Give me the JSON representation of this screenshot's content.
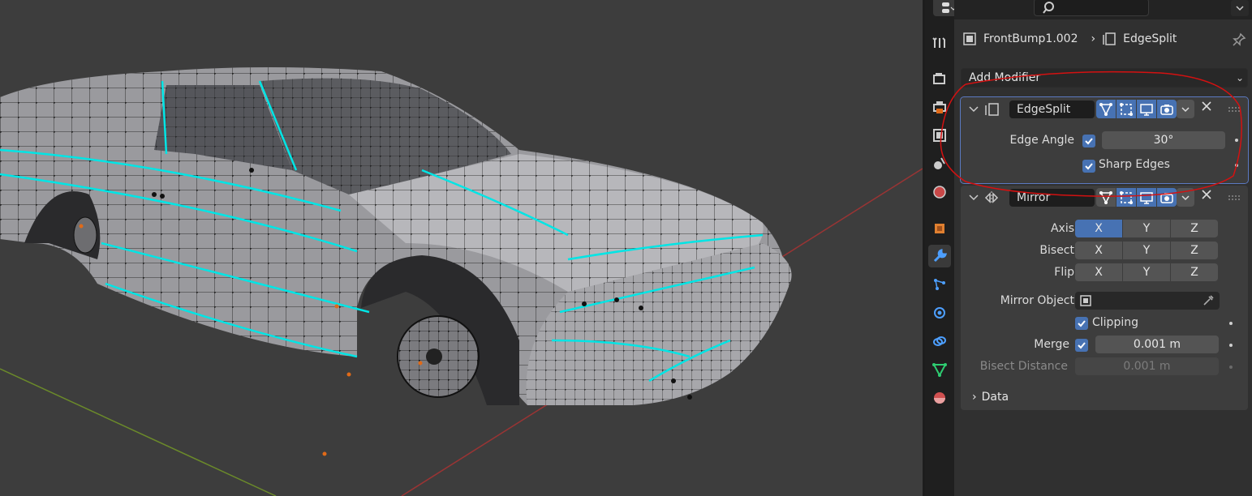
{
  "properties": {
    "breadcrumb": {
      "object_name": "FrontBump1.002",
      "modifier_name": "EdgeSplit"
    },
    "add_modifier_label": "Add Modifier",
    "edgesplit": {
      "name": "EdgeSplit",
      "edge_angle_label": "Edge Angle",
      "edge_angle_value": "30°",
      "edge_angle_enabled": true,
      "sharp_edges_label": "Sharp Edges",
      "sharp_edges_enabled": true
    },
    "mirror": {
      "name": "Mirror",
      "axis_label": "Axis",
      "bisect_label": "Bisect",
      "flip_label": "Flip",
      "axes": [
        "X",
        "Y",
        "Z"
      ],
      "axis_active": "X",
      "mirror_object_label": "Mirror Object",
      "clipping_label": "Clipping",
      "merge_label": "Merge",
      "merge_value": "0.001 m",
      "bisect_distance_label": "Bisect Distance",
      "bisect_distance_value": "0.001 m",
      "data_subpanel_label": "Data"
    }
  },
  "tabs": [
    "tool",
    "render",
    "output",
    "view-layer",
    "scene",
    "world",
    "object",
    "modifiers",
    "particles",
    "physics",
    "constraints",
    "data",
    "material"
  ],
  "active_tab": "modifiers",
  "colors": {
    "accent": "#4772b3",
    "annotation": "#d41111",
    "seam_edges": "#00e5e5"
  }
}
